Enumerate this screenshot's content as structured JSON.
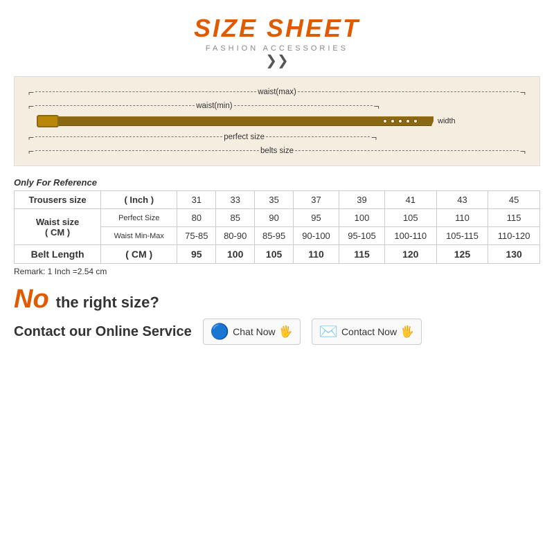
{
  "header": {
    "title": "SIZE SHEET",
    "subtitle": "FASHION ACCESSORIES",
    "chevrons": "≫"
  },
  "belt_diagram": {
    "rows": [
      {
        "label": "waist(max)"
      },
      {
        "label": "waist(min)"
      },
      {
        "label": "perfect size"
      },
      {
        "label": "belts size"
      }
    ],
    "width_label": "width"
  },
  "table": {
    "reference_label": "Only For Reference",
    "columns": [
      "31",
      "33",
      "35",
      "37",
      "39",
      "41",
      "43",
      "45"
    ],
    "trousers_size_label": "Trousers size",
    "inch_label": "( Inch )",
    "waist_size_label": "Waist size",
    "waist_cm_label": "( CM )",
    "perfect_size_label": "Perfect Size",
    "waist_min_max_label": "Waist Min-Max",
    "belt_length_label": "Belt Length",
    "belt_length_cm_label": "( CM )",
    "perfect_values": [
      "80",
      "85",
      "90",
      "95",
      "100",
      "105",
      "110",
      "115"
    ],
    "waist_minmax_values": [
      "75-85",
      "80-90",
      "85-95",
      "90-100",
      "95-105",
      "100-110",
      "105-115",
      "110-120"
    ],
    "belt_length_values": [
      "95",
      "100",
      "105",
      "110",
      "115",
      "120",
      "125",
      "130"
    ],
    "remark": "Remark: 1 Inch =2.54 cm"
  },
  "bottom": {
    "no_text": "No",
    "question": "the right size?",
    "contact_text": "Contact our Online Service",
    "chat_label": "Chat Now",
    "contact_label": "Contact Now"
  }
}
